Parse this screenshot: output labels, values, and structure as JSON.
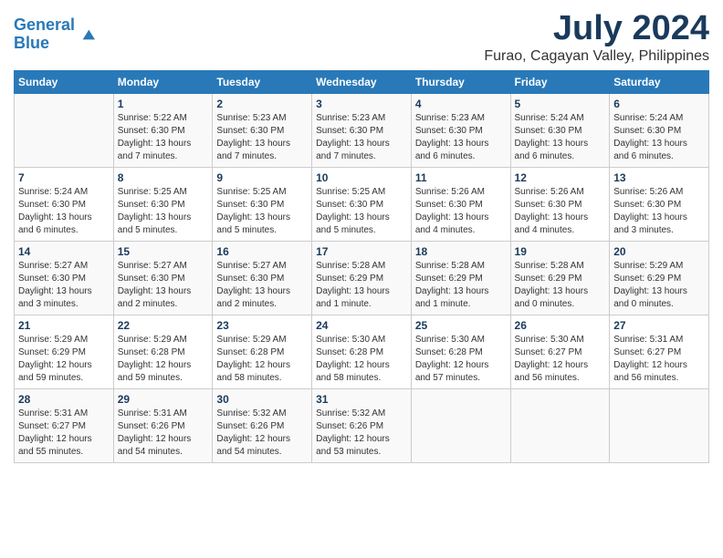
{
  "header": {
    "logo_line1": "General",
    "logo_line2": "Blue",
    "title": "July 2024",
    "subtitle": "Furao, Cagayan Valley, Philippines"
  },
  "calendar": {
    "weekdays": [
      "Sunday",
      "Monday",
      "Tuesday",
      "Wednesday",
      "Thursday",
      "Friday",
      "Saturday"
    ],
    "rows": [
      [
        {
          "day": "",
          "info": ""
        },
        {
          "day": "1",
          "info": "Sunrise: 5:22 AM\nSunset: 6:30 PM\nDaylight: 13 hours\nand 7 minutes."
        },
        {
          "day": "2",
          "info": "Sunrise: 5:23 AM\nSunset: 6:30 PM\nDaylight: 13 hours\nand 7 minutes."
        },
        {
          "day": "3",
          "info": "Sunrise: 5:23 AM\nSunset: 6:30 PM\nDaylight: 13 hours\nand 7 minutes."
        },
        {
          "day": "4",
          "info": "Sunrise: 5:23 AM\nSunset: 6:30 PM\nDaylight: 13 hours\nand 6 minutes."
        },
        {
          "day": "5",
          "info": "Sunrise: 5:24 AM\nSunset: 6:30 PM\nDaylight: 13 hours\nand 6 minutes."
        },
        {
          "day": "6",
          "info": "Sunrise: 5:24 AM\nSunset: 6:30 PM\nDaylight: 13 hours\nand 6 minutes."
        }
      ],
      [
        {
          "day": "7",
          "info": "Sunrise: 5:24 AM\nSunset: 6:30 PM\nDaylight: 13 hours\nand 6 minutes."
        },
        {
          "day": "8",
          "info": "Sunrise: 5:25 AM\nSunset: 6:30 PM\nDaylight: 13 hours\nand 5 minutes."
        },
        {
          "day": "9",
          "info": "Sunrise: 5:25 AM\nSunset: 6:30 PM\nDaylight: 13 hours\nand 5 minutes."
        },
        {
          "day": "10",
          "info": "Sunrise: 5:25 AM\nSunset: 6:30 PM\nDaylight: 13 hours\nand 5 minutes."
        },
        {
          "day": "11",
          "info": "Sunrise: 5:26 AM\nSunset: 6:30 PM\nDaylight: 13 hours\nand 4 minutes."
        },
        {
          "day": "12",
          "info": "Sunrise: 5:26 AM\nSunset: 6:30 PM\nDaylight: 13 hours\nand 4 minutes."
        },
        {
          "day": "13",
          "info": "Sunrise: 5:26 AM\nSunset: 6:30 PM\nDaylight: 13 hours\nand 3 minutes."
        }
      ],
      [
        {
          "day": "14",
          "info": "Sunrise: 5:27 AM\nSunset: 6:30 PM\nDaylight: 13 hours\nand 3 minutes."
        },
        {
          "day": "15",
          "info": "Sunrise: 5:27 AM\nSunset: 6:30 PM\nDaylight: 13 hours\nand 2 minutes."
        },
        {
          "day": "16",
          "info": "Sunrise: 5:27 AM\nSunset: 6:30 PM\nDaylight: 13 hours\nand 2 minutes."
        },
        {
          "day": "17",
          "info": "Sunrise: 5:28 AM\nSunset: 6:29 PM\nDaylight: 13 hours\nand 1 minute."
        },
        {
          "day": "18",
          "info": "Sunrise: 5:28 AM\nSunset: 6:29 PM\nDaylight: 13 hours\nand 1 minute."
        },
        {
          "day": "19",
          "info": "Sunrise: 5:28 AM\nSunset: 6:29 PM\nDaylight: 13 hours\nand 0 minutes."
        },
        {
          "day": "20",
          "info": "Sunrise: 5:29 AM\nSunset: 6:29 PM\nDaylight: 13 hours\nand 0 minutes."
        }
      ],
      [
        {
          "day": "21",
          "info": "Sunrise: 5:29 AM\nSunset: 6:29 PM\nDaylight: 12 hours\nand 59 minutes."
        },
        {
          "day": "22",
          "info": "Sunrise: 5:29 AM\nSunset: 6:28 PM\nDaylight: 12 hours\nand 59 minutes."
        },
        {
          "day": "23",
          "info": "Sunrise: 5:29 AM\nSunset: 6:28 PM\nDaylight: 12 hours\nand 58 minutes."
        },
        {
          "day": "24",
          "info": "Sunrise: 5:30 AM\nSunset: 6:28 PM\nDaylight: 12 hours\nand 58 minutes."
        },
        {
          "day": "25",
          "info": "Sunrise: 5:30 AM\nSunset: 6:28 PM\nDaylight: 12 hours\nand 57 minutes."
        },
        {
          "day": "26",
          "info": "Sunrise: 5:30 AM\nSunset: 6:27 PM\nDaylight: 12 hours\nand 56 minutes."
        },
        {
          "day": "27",
          "info": "Sunrise: 5:31 AM\nSunset: 6:27 PM\nDaylight: 12 hours\nand 56 minutes."
        }
      ],
      [
        {
          "day": "28",
          "info": "Sunrise: 5:31 AM\nSunset: 6:27 PM\nDaylight: 12 hours\nand 55 minutes."
        },
        {
          "day": "29",
          "info": "Sunrise: 5:31 AM\nSunset: 6:26 PM\nDaylight: 12 hours\nand 54 minutes."
        },
        {
          "day": "30",
          "info": "Sunrise: 5:32 AM\nSunset: 6:26 PM\nDaylight: 12 hours\nand 54 minutes."
        },
        {
          "day": "31",
          "info": "Sunrise: 5:32 AM\nSunset: 6:26 PM\nDaylight: 12 hours\nand 53 minutes."
        },
        {
          "day": "",
          "info": ""
        },
        {
          "day": "",
          "info": ""
        },
        {
          "day": "",
          "info": ""
        }
      ]
    ]
  }
}
